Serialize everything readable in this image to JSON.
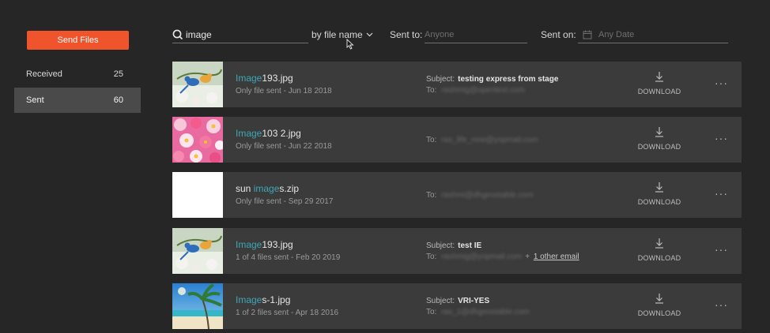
{
  "sidebar": {
    "send_files_label": "Send Files",
    "items": [
      {
        "label": "Received",
        "count": "25"
      },
      {
        "label": "Sent",
        "count": "60"
      }
    ]
  },
  "search": {
    "value": "image",
    "filter_label": "by file name",
    "sent_to_label": "Sent to:",
    "sent_to_placeholder": "Anyone",
    "sent_on_label": "Sent on:",
    "sent_on_placeholder": "Any Date"
  },
  "rows": [
    {
      "name_hl": "Image",
      "name_rest": "193.jpg",
      "meta": "Only file sent - Jun 18 2018",
      "subject_label": "Subject:",
      "subject": "testing express from stage",
      "to_label": "To:",
      "to": "rashmig@opentext.com",
      "download_label": "DOWNLOAD",
      "more": "···"
    },
    {
      "name_hl": "Image",
      "name_rest": "103 2.jpg",
      "meta": "Only file sent - Jun 22 2018",
      "to_label": "To:",
      "to": "ras_life_new@yopmail.com",
      "download_label": "DOWNLOAD",
      "more": "···"
    },
    {
      "name_pre": "sun ",
      "name_hl": "image",
      "name_rest": "s.zip",
      "meta": "Only file sent - Sep 29 2017",
      "to_label": "To:",
      "to": "rashmi@dhgeostable.com",
      "download_label": "DOWNLOAD",
      "more": "···"
    },
    {
      "name_hl": "Image",
      "name_rest": "193.jpg",
      "meta": "1 of 4 files sent - Feb 20 2019",
      "subject_label": "Subject:",
      "subject": "test IE",
      "to_label": "To:",
      "to": "rashmig@yopmail.com",
      "plus": "+",
      "other_email": "1 other email",
      "download_label": "DOWNLOAD",
      "more": "···"
    },
    {
      "name_hl": "Image",
      "name_rest": "s-1.jpg",
      "meta": "1 of 2 files sent - Apr 18 2016",
      "subject_label": "Subject:",
      "subject": "VRI-YES",
      "to_label": "To:",
      "to": "ras_1@dhgeostable.com",
      "download_label": "DOWNLOAD",
      "more": "···"
    }
  ]
}
